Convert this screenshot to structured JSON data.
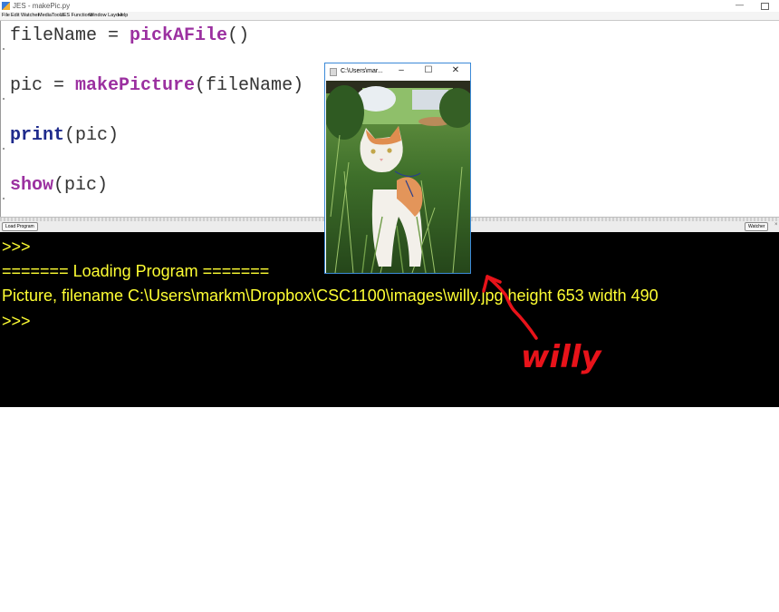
{
  "window": {
    "title": "JES - makePic.py",
    "minimize_glyph": "—"
  },
  "menu": [
    "File",
    "Edit",
    "Watcher",
    "MediaTools",
    "JES Functions",
    "Window Layout",
    "Help"
  ],
  "editor": {
    "lines": [
      {
        "pre": "fileName = ",
        "kw": "pickAFile",
        "post": "()",
        "kw_color": "#9b30a0"
      },
      {
        "pre": "pic = ",
        "kw": "makePicture",
        "post": "(fileName)",
        "kw_color": "#9b30a0"
      },
      {
        "pre": "",
        "kw": "print",
        "post": "(pic)",
        "kw_color": "#1e2a8c"
      },
      {
        "pre": "",
        "kw": "show",
        "post": "(pic)",
        "kw_color": "#9b30a0"
      }
    ]
  },
  "buttons": {
    "load_program": "Load Program",
    "watcher": "Watcher"
  },
  "console": {
    "lines": [
      ">>>",
      "======= Loading Program =======",
      "Picture, filename C:\\Users\\markm\\Dropbox\\CSC1100\\images\\willy.jpg height 653 width 490",
      ">>>"
    ],
    "text_color": "#ffff33"
  },
  "picture_window": {
    "title": "C:\\Users\\mar..."
  },
  "annotation": {
    "handwritten_label": "willy",
    "color": "#e8131a"
  }
}
